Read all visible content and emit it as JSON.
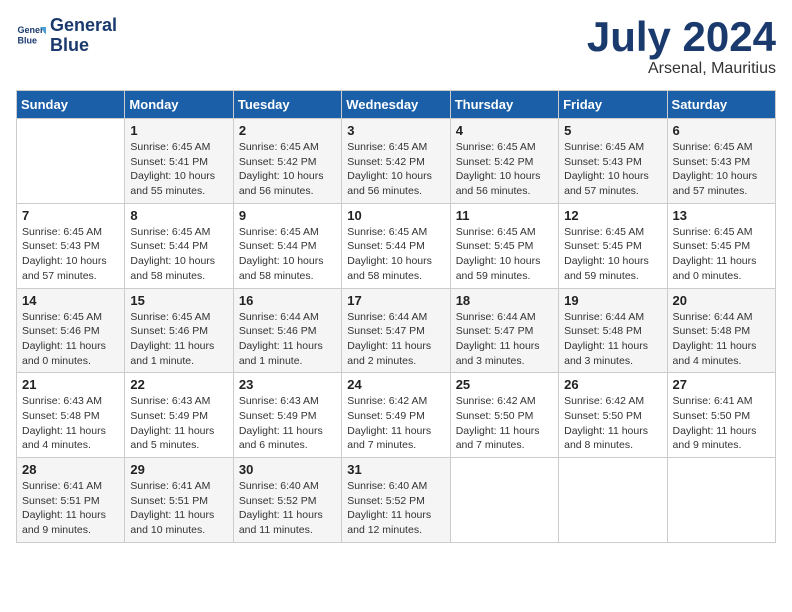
{
  "header": {
    "logo_line1": "General",
    "logo_line2": "Blue",
    "month": "July 2024",
    "location": "Arsenal, Mauritius"
  },
  "days_of_week": [
    "Sunday",
    "Monday",
    "Tuesday",
    "Wednesday",
    "Thursday",
    "Friday",
    "Saturday"
  ],
  "weeks": [
    [
      {
        "day": "",
        "info": ""
      },
      {
        "day": "1",
        "info": "Sunrise: 6:45 AM\nSunset: 5:41 PM\nDaylight: 10 hours\nand 55 minutes."
      },
      {
        "day": "2",
        "info": "Sunrise: 6:45 AM\nSunset: 5:42 PM\nDaylight: 10 hours\nand 56 minutes."
      },
      {
        "day": "3",
        "info": "Sunrise: 6:45 AM\nSunset: 5:42 PM\nDaylight: 10 hours\nand 56 minutes."
      },
      {
        "day": "4",
        "info": "Sunrise: 6:45 AM\nSunset: 5:42 PM\nDaylight: 10 hours\nand 56 minutes."
      },
      {
        "day": "5",
        "info": "Sunrise: 6:45 AM\nSunset: 5:43 PM\nDaylight: 10 hours\nand 57 minutes."
      },
      {
        "day": "6",
        "info": "Sunrise: 6:45 AM\nSunset: 5:43 PM\nDaylight: 10 hours\nand 57 minutes."
      }
    ],
    [
      {
        "day": "7",
        "info": "Sunrise: 6:45 AM\nSunset: 5:43 PM\nDaylight: 10 hours\nand 57 minutes."
      },
      {
        "day": "8",
        "info": "Sunrise: 6:45 AM\nSunset: 5:44 PM\nDaylight: 10 hours\nand 58 minutes."
      },
      {
        "day": "9",
        "info": "Sunrise: 6:45 AM\nSunset: 5:44 PM\nDaylight: 10 hours\nand 58 minutes."
      },
      {
        "day": "10",
        "info": "Sunrise: 6:45 AM\nSunset: 5:44 PM\nDaylight: 10 hours\nand 58 minutes."
      },
      {
        "day": "11",
        "info": "Sunrise: 6:45 AM\nSunset: 5:45 PM\nDaylight: 10 hours\nand 59 minutes."
      },
      {
        "day": "12",
        "info": "Sunrise: 6:45 AM\nSunset: 5:45 PM\nDaylight: 10 hours\nand 59 minutes."
      },
      {
        "day": "13",
        "info": "Sunrise: 6:45 AM\nSunset: 5:45 PM\nDaylight: 11 hours\nand 0 minutes."
      }
    ],
    [
      {
        "day": "14",
        "info": "Sunrise: 6:45 AM\nSunset: 5:46 PM\nDaylight: 11 hours\nand 0 minutes."
      },
      {
        "day": "15",
        "info": "Sunrise: 6:45 AM\nSunset: 5:46 PM\nDaylight: 11 hours\nand 1 minute."
      },
      {
        "day": "16",
        "info": "Sunrise: 6:44 AM\nSunset: 5:46 PM\nDaylight: 11 hours\nand 1 minute."
      },
      {
        "day": "17",
        "info": "Sunrise: 6:44 AM\nSunset: 5:47 PM\nDaylight: 11 hours\nand 2 minutes."
      },
      {
        "day": "18",
        "info": "Sunrise: 6:44 AM\nSunset: 5:47 PM\nDaylight: 11 hours\nand 3 minutes."
      },
      {
        "day": "19",
        "info": "Sunrise: 6:44 AM\nSunset: 5:48 PM\nDaylight: 11 hours\nand 3 minutes."
      },
      {
        "day": "20",
        "info": "Sunrise: 6:44 AM\nSunset: 5:48 PM\nDaylight: 11 hours\nand 4 minutes."
      }
    ],
    [
      {
        "day": "21",
        "info": "Sunrise: 6:43 AM\nSunset: 5:48 PM\nDaylight: 11 hours\nand 4 minutes."
      },
      {
        "day": "22",
        "info": "Sunrise: 6:43 AM\nSunset: 5:49 PM\nDaylight: 11 hours\nand 5 minutes."
      },
      {
        "day": "23",
        "info": "Sunrise: 6:43 AM\nSunset: 5:49 PM\nDaylight: 11 hours\nand 6 minutes."
      },
      {
        "day": "24",
        "info": "Sunrise: 6:42 AM\nSunset: 5:49 PM\nDaylight: 11 hours\nand 7 minutes."
      },
      {
        "day": "25",
        "info": "Sunrise: 6:42 AM\nSunset: 5:50 PM\nDaylight: 11 hours\nand 7 minutes."
      },
      {
        "day": "26",
        "info": "Sunrise: 6:42 AM\nSunset: 5:50 PM\nDaylight: 11 hours\nand 8 minutes."
      },
      {
        "day": "27",
        "info": "Sunrise: 6:41 AM\nSunset: 5:50 PM\nDaylight: 11 hours\nand 9 minutes."
      }
    ],
    [
      {
        "day": "28",
        "info": "Sunrise: 6:41 AM\nSunset: 5:51 PM\nDaylight: 11 hours\nand 9 minutes."
      },
      {
        "day": "29",
        "info": "Sunrise: 6:41 AM\nSunset: 5:51 PM\nDaylight: 11 hours\nand 10 minutes."
      },
      {
        "day": "30",
        "info": "Sunrise: 6:40 AM\nSunset: 5:52 PM\nDaylight: 11 hours\nand 11 minutes."
      },
      {
        "day": "31",
        "info": "Sunrise: 6:40 AM\nSunset: 5:52 PM\nDaylight: 11 hours\nand 12 minutes."
      },
      {
        "day": "",
        "info": ""
      },
      {
        "day": "",
        "info": ""
      },
      {
        "day": "",
        "info": ""
      }
    ]
  ]
}
